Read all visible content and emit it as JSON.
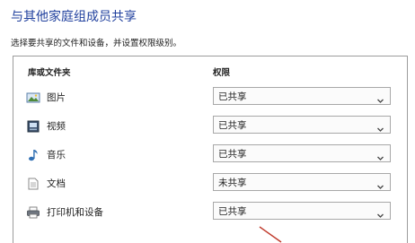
{
  "header": {
    "title": "与其他家庭组成员共享",
    "subtitle": "选择要共享的文件和设备，并设置权限级别。"
  },
  "table": {
    "columns": {
      "library": "库或文件夹",
      "permission": "权限"
    },
    "rows": [
      {
        "label": "图片",
        "icon": "pictures-icon",
        "permission": "已共享"
      },
      {
        "label": "视频",
        "icon": "videos-icon",
        "permission": "已共享"
      },
      {
        "label": "音乐",
        "icon": "music-icon",
        "permission": "已共享"
      },
      {
        "label": "文档",
        "icon": "documents-icon",
        "permission": "未共享"
      },
      {
        "label": "打印机和设备",
        "icon": "printer-icon",
        "permission": "已共享"
      }
    ]
  },
  "colors": {
    "title": "#1f3f9d",
    "border": "#9c9c9c",
    "annotation_arrow": "#c0392b"
  }
}
